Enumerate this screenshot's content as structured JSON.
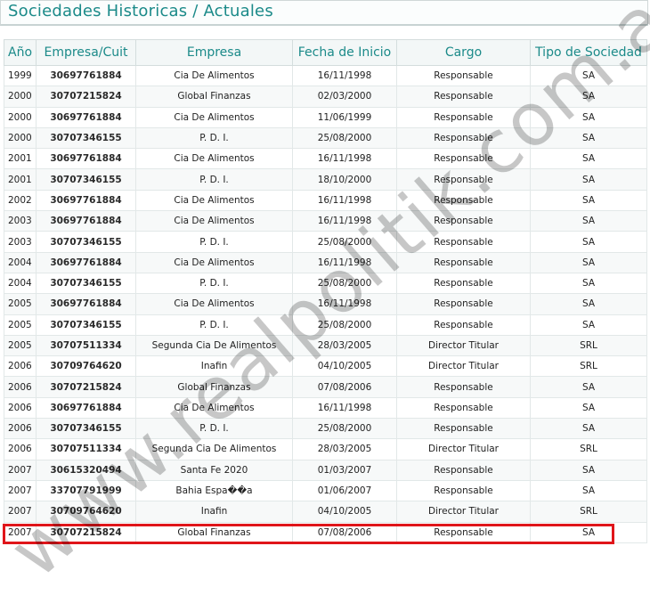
{
  "page": {
    "title": "Sociedades Historicas / Actuales",
    "watermark": "www.realpolitik.com.ar"
  },
  "table": {
    "headers": [
      "Año",
      "Empresa/Cuit",
      "Empresa",
      "Fecha de Inicio",
      "Cargo",
      "Tipo de Sociedad"
    ],
    "rows": [
      [
        "1999",
        "30697761884",
        "Cia De Alimentos",
        "16/11/1998",
        "Responsable",
        "SA"
      ],
      [
        "2000",
        "30707215824",
        "Global Finanzas",
        "02/03/2000",
        "Responsable",
        "SA"
      ],
      [
        "2000",
        "30697761884",
        "Cia De Alimentos",
        "11/06/1999",
        "Responsable",
        "SA"
      ],
      [
        "2000",
        "30707346155",
        "P. D. I.",
        "25/08/2000",
        "Responsable",
        "SA"
      ],
      [
        "2001",
        "30697761884",
        "Cia De Alimentos",
        "16/11/1998",
        "Responsable",
        "SA"
      ],
      [
        "2001",
        "30707346155",
        "P. D. I.",
        "18/10/2000",
        "Responsable",
        "SA"
      ],
      [
        "2002",
        "30697761884",
        "Cia De Alimentos",
        "16/11/1998",
        "Responsable",
        "SA"
      ],
      [
        "2003",
        "30697761884",
        "Cia De Alimentos",
        "16/11/1998",
        "Responsable",
        "SA"
      ],
      [
        "2003",
        "30707346155",
        "P. D. I.",
        "25/08/2000",
        "Responsable",
        "SA"
      ],
      [
        "2004",
        "30697761884",
        "Cia De Alimentos",
        "16/11/1998",
        "Responsable",
        "SA"
      ],
      [
        "2004",
        "30707346155",
        "P. D. I.",
        "25/08/2000",
        "Responsable",
        "SA"
      ],
      [
        "2005",
        "30697761884",
        "Cia De Alimentos",
        "16/11/1998",
        "Responsable",
        "SA"
      ],
      [
        "2005",
        "30707346155",
        "P. D. I.",
        "25/08/2000",
        "Responsable",
        "SA"
      ],
      [
        "2005",
        "30707511334",
        "Segunda Cia De Alimentos",
        "28/03/2005",
        "Director Titular",
        "SRL"
      ],
      [
        "2006",
        "30709764620",
        "Inafin",
        "04/10/2005",
        "Director Titular",
        "SRL"
      ],
      [
        "2006",
        "30707215824",
        "Global Finanzas",
        "07/08/2006",
        "Responsable",
        "SA"
      ],
      [
        "2006",
        "30697761884",
        "Cia De Alimentos",
        "16/11/1998",
        "Responsable",
        "SA"
      ],
      [
        "2006",
        "30707346155",
        "P. D. I.",
        "25/08/2000",
        "Responsable",
        "SA"
      ],
      [
        "2006",
        "30707511334",
        "Segunda Cia De Alimentos",
        "28/03/2005",
        "Director Titular",
        "SRL"
      ],
      [
        "2007",
        "30615320494",
        "Santa Fe 2020",
        "01/03/2007",
        "Responsable",
        "SA"
      ],
      [
        "2007",
        "33707791999",
        "Bahia Espa��a",
        "01/06/2007",
        "Responsable",
        "SA"
      ],
      [
        "2007",
        "30709764620",
        "Inafin",
        "04/10/2005",
        "Director Titular",
        "SRL"
      ],
      [
        "2007",
        "30707215824",
        "Global Finanzas",
        "07/08/2006",
        "Responsable",
        "SA"
      ]
    ]
  },
  "colors": {
    "accent": "#1b8a89",
    "highlight": "#e0151a"
  }
}
